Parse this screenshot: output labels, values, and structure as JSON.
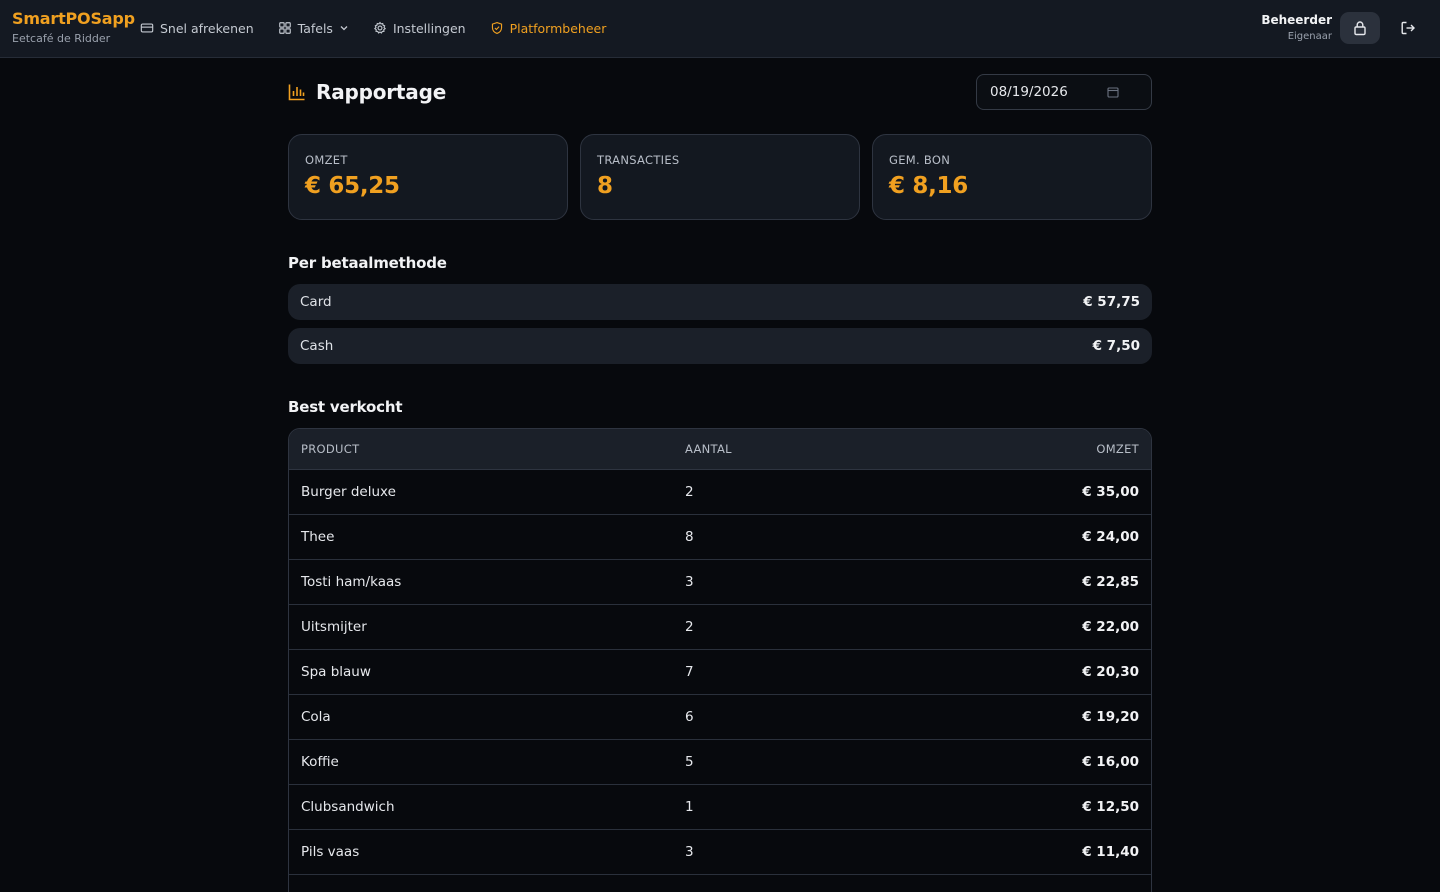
{
  "app": {
    "brand": "SmartPOSapp",
    "venue": "Eetcafé de Ridder"
  },
  "nav": {
    "quick_checkout": "Snel afrekenen",
    "tables": "Tafels",
    "settings": "Instellingen",
    "platform": "Platformbeheer"
  },
  "user": {
    "name": "Beheerder",
    "role": "Eigenaar"
  },
  "page": {
    "title": "Rapportage",
    "date": "08/19/2026"
  },
  "stats": {
    "revenue_label": "OMZET",
    "revenue_value": "€ 65,25",
    "transactions_label": "TRANSACTIES",
    "transactions_value": "8",
    "avg_label": "GEM. BON",
    "avg_value": "€ 8,16"
  },
  "payments": {
    "title": "Per betaalmethode",
    "rows": [
      {
        "method": "Card",
        "amount": "€ 57,75"
      },
      {
        "method": "Cash",
        "amount": "€ 7,50"
      }
    ]
  },
  "bestsellers": {
    "title": "Best verkocht",
    "headers": {
      "product": "PRODUCT",
      "qty": "AANTAL",
      "revenue": "OMZET"
    },
    "rows": [
      {
        "product": "Burger deluxe",
        "qty": "2",
        "revenue": "€ 35,00"
      },
      {
        "product": "Thee",
        "qty": "8",
        "revenue": "€ 24,00"
      },
      {
        "product": "Tosti ham/kaas",
        "qty": "3",
        "revenue": "€ 22,85"
      },
      {
        "product": "Uitsmijter",
        "qty": "2",
        "revenue": "€ 22,00"
      },
      {
        "product": "Spa blauw",
        "qty": "7",
        "revenue": "€ 20,30"
      },
      {
        "product": "Cola",
        "qty": "6",
        "revenue": "€ 19,20"
      },
      {
        "product": "Koffie",
        "qty": "5",
        "revenue": "€ 16,00"
      },
      {
        "product": "Clubsandwich",
        "qty": "1",
        "revenue": "€ 12,50"
      },
      {
        "product": "Pils vaas",
        "qty": "3",
        "revenue": "€ 11,40"
      }
    ]
  },
  "colors": {
    "accent": "#f0a020",
    "background": "#07090d",
    "surface": "#131820"
  },
  "icons": [
    "card-icon",
    "grid-icon",
    "chevron-down-icon",
    "gear-icon",
    "shield-icon",
    "lock-icon",
    "logout-icon",
    "bar-chart-icon",
    "calendar-icon"
  ]
}
